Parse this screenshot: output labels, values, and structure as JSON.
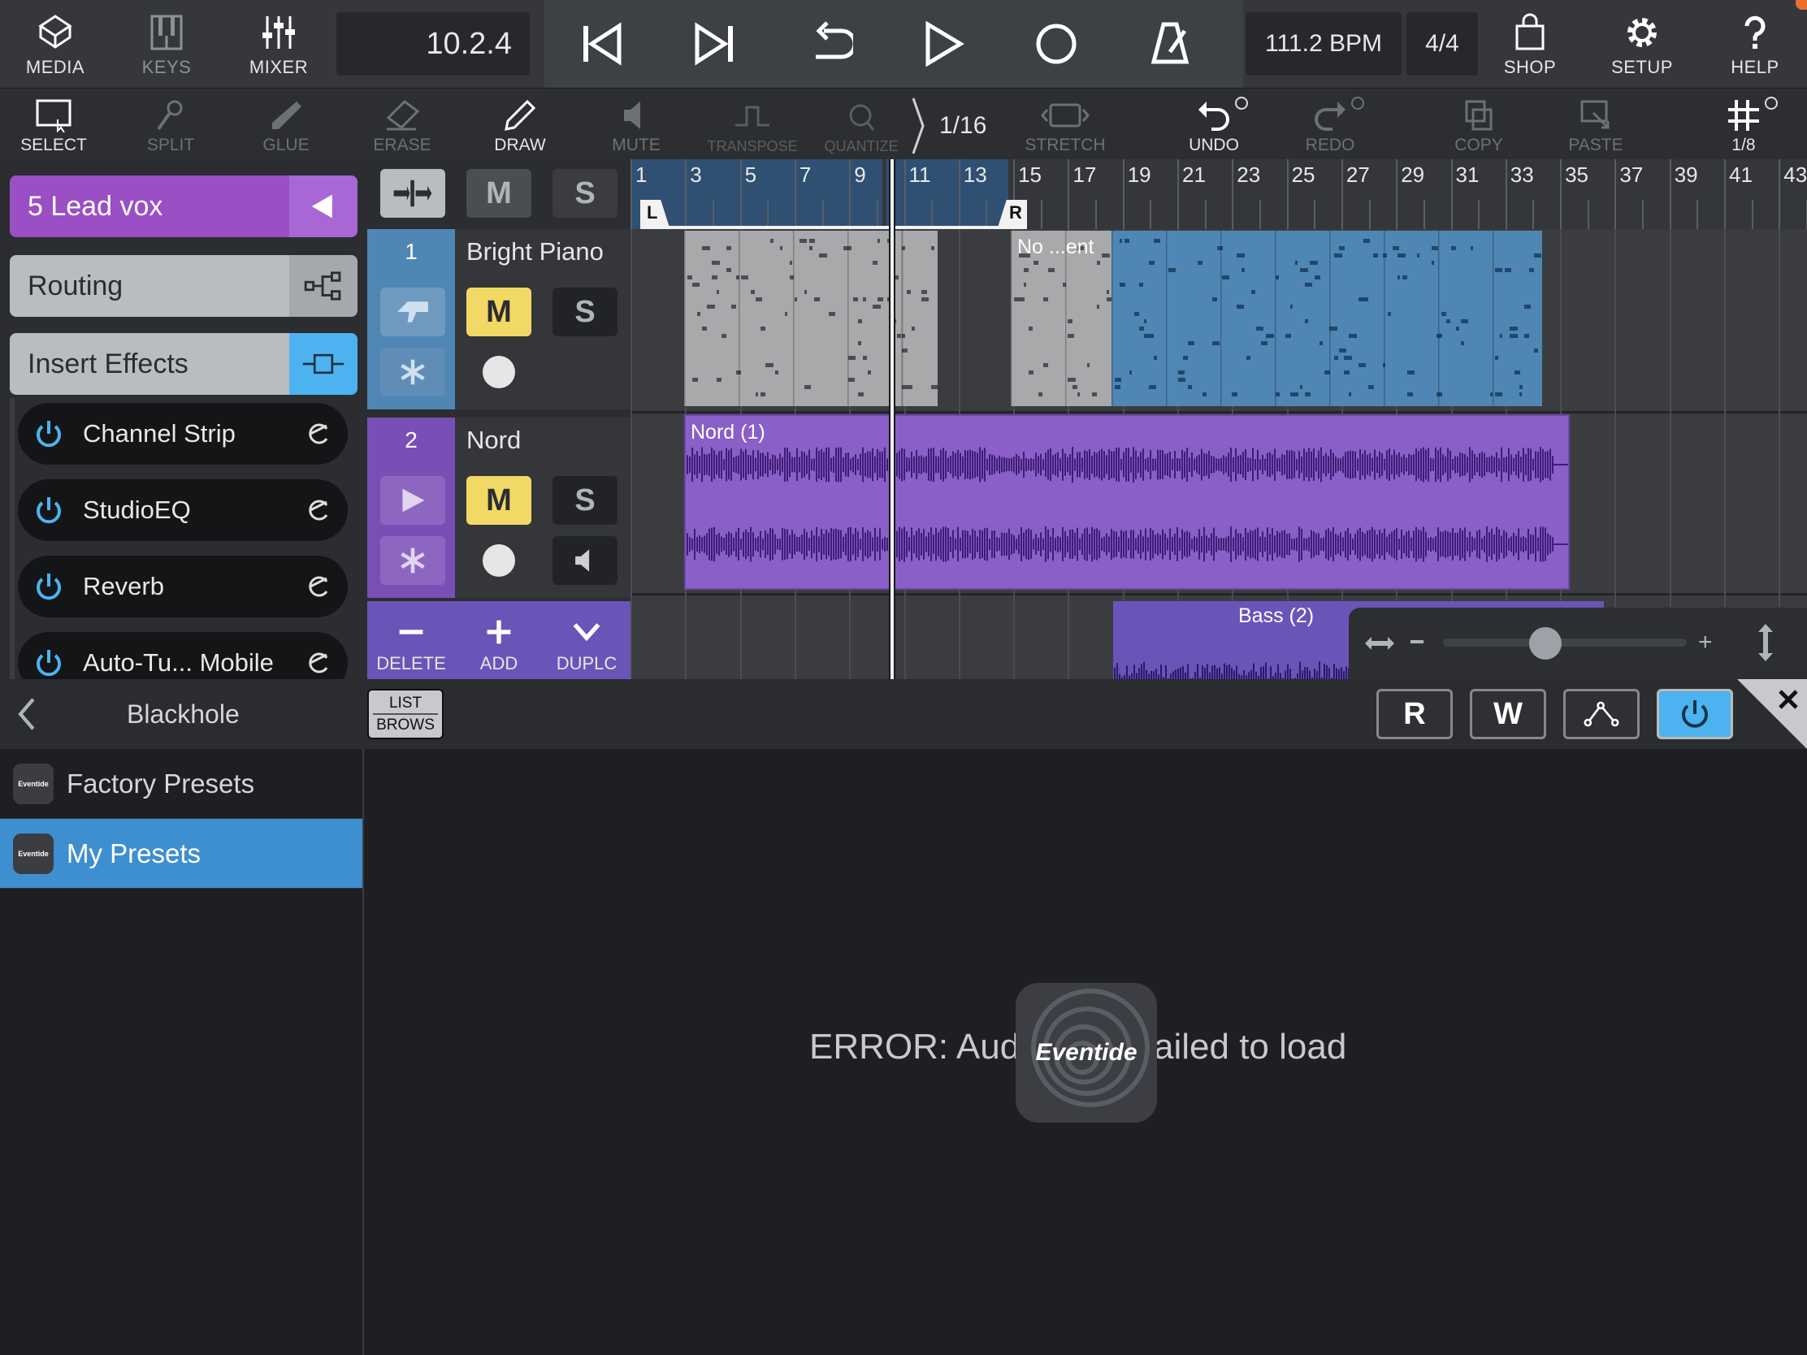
{
  "topbar": {
    "media": "MEDIA",
    "keys": "KEYS",
    "mixer": "MIXER",
    "position": "10.2.4",
    "tempo": "111.2 BPM",
    "signature": "4/4",
    "shop": "SHOP",
    "setup": "SETUP",
    "help": "HELP"
  },
  "toolbar": {
    "select": "SELECT",
    "split": "SPLIT",
    "glue": "GLUE",
    "erase": "ERASE",
    "draw": "DRAW",
    "mute": "MUTE",
    "transpose": "TRANSPOSE",
    "quantize": "QUANTIZE",
    "quantize_value": "1/16",
    "stretch": "STRETCH",
    "undo": "UNDO",
    "redo": "REDO",
    "copy": "COPY",
    "paste": "PASTE",
    "grid_value": "1/8"
  },
  "inspector": {
    "track": "5  Lead vox",
    "routing": "Routing",
    "insert_effects": "Insert Effects",
    "effects": [
      "Channel Strip",
      "StudioEQ",
      "Reverb",
      "Auto-Tu... Mobile"
    ]
  },
  "tracks": [
    {
      "number": "1",
      "name": "Bright Piano",
      "mute": "M",
      "solo": "S"
    },
    {
      "number": "2",
      "name": "Nord",
      "mute": "M",
      "solo": "S"
    }
  ],
  "header_buttons": {
    "mute": "M",
    "solo": "S"
  },
  "track_actions": {
    "delete": "DELETE",
    "add": "ADD",
    "duplicate": "DUPLC"
  },
  "ruler": {
    "bars": [
      "1",
      "3",
      "5",
      "7",
      "9",
      "11",
      "13",
      "15",
      "17",
      "19",
      "21",
      "23",
      "25",
      "27",
      "29",
      "31",
      "33",
      "35",
      "37",
      "39",
      "41",
      "43"
    ],
    "left_locator": "L",
    "right_locator": "R"
  },
  "clips": {
    "piano_second": "No ...ent",
    "nord": "Nord (1)",
    "bass": "Bass (2)"
  },
  "browser": {
    "back_title": "Blackhole",
    "list_label_1": "LIST",
    "list_label_2": "BROWS",
    "read": "R",
    "write": "W",
    "presets": [
      "Factory Presets",
      "My Presets"
    ],
    "selected_preset": "My Presets",
    "logo_text": "Eventide",
    "error_left": "ERROR: Aud",
    "error_right": "ailed to load",
    "center_logo": "Eventide"
  },
  "colors": {
    "lead_track": "#9a4fc4",
    "insert_accent": "#4db3f0",
    "mute_active": "#f2d864",
    "piano_clip": "#4f86b4",
    "nord_clip": "#7a4fb5",
    "selected_preset": "#3e8fd0"
  }
}
